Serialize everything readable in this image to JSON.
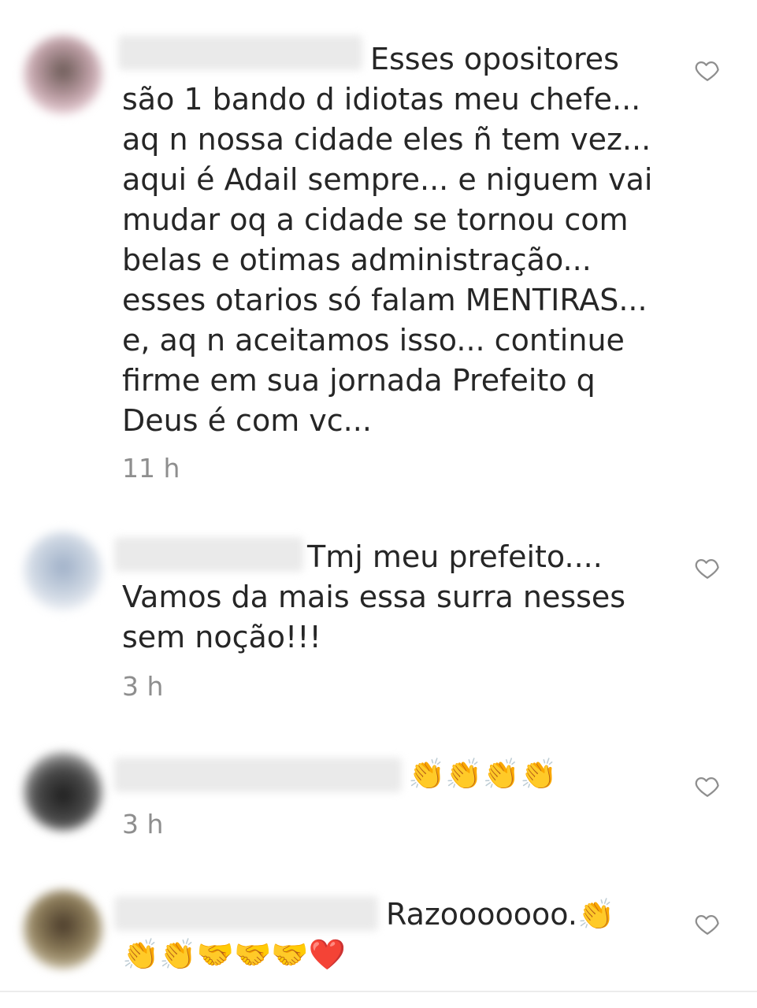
{
  "comments": [
    {
      "text": "Esses opositores são 1 bando d idiotas meu chefe... aq n nossa cidade eles ñ tem vez... aqui é Adail sempre... e niguem vai mudar oq a cidade se tornou com belas e otimas administração... esses otarios só falam MENTIRAS... e, aq n aceitamos isso... continue firme em sua jornada Prefeito q Deus é com vc...",
      "time": "11 h",
      "avatar_color": "#e8c9d2",
      "like_icon": "heart-outline-icon"
    },
    {
      "text": "Tmj meu prefeito.... Vamos da mais essa surra nesses sem noção!!!",
      "time": "3 h",
      "avatar_color": "#d8dde6",
      "like_icon": "heart-outline-icon"
    },
    {
      "text": "👏👏👏👏",
      "time": "3 h",
      "avatar_color": "#3a3a3a",
      "like_icon": "heart-outline-icon"
    },
    {
      "text": "Razooooooo.👏👏👏🤝🤝🤝❤️",
      "time": "",
      "avatar_color": "#7a6a4a",
      "like_icon": "heart-outline-icon"
    }
  ]
}
